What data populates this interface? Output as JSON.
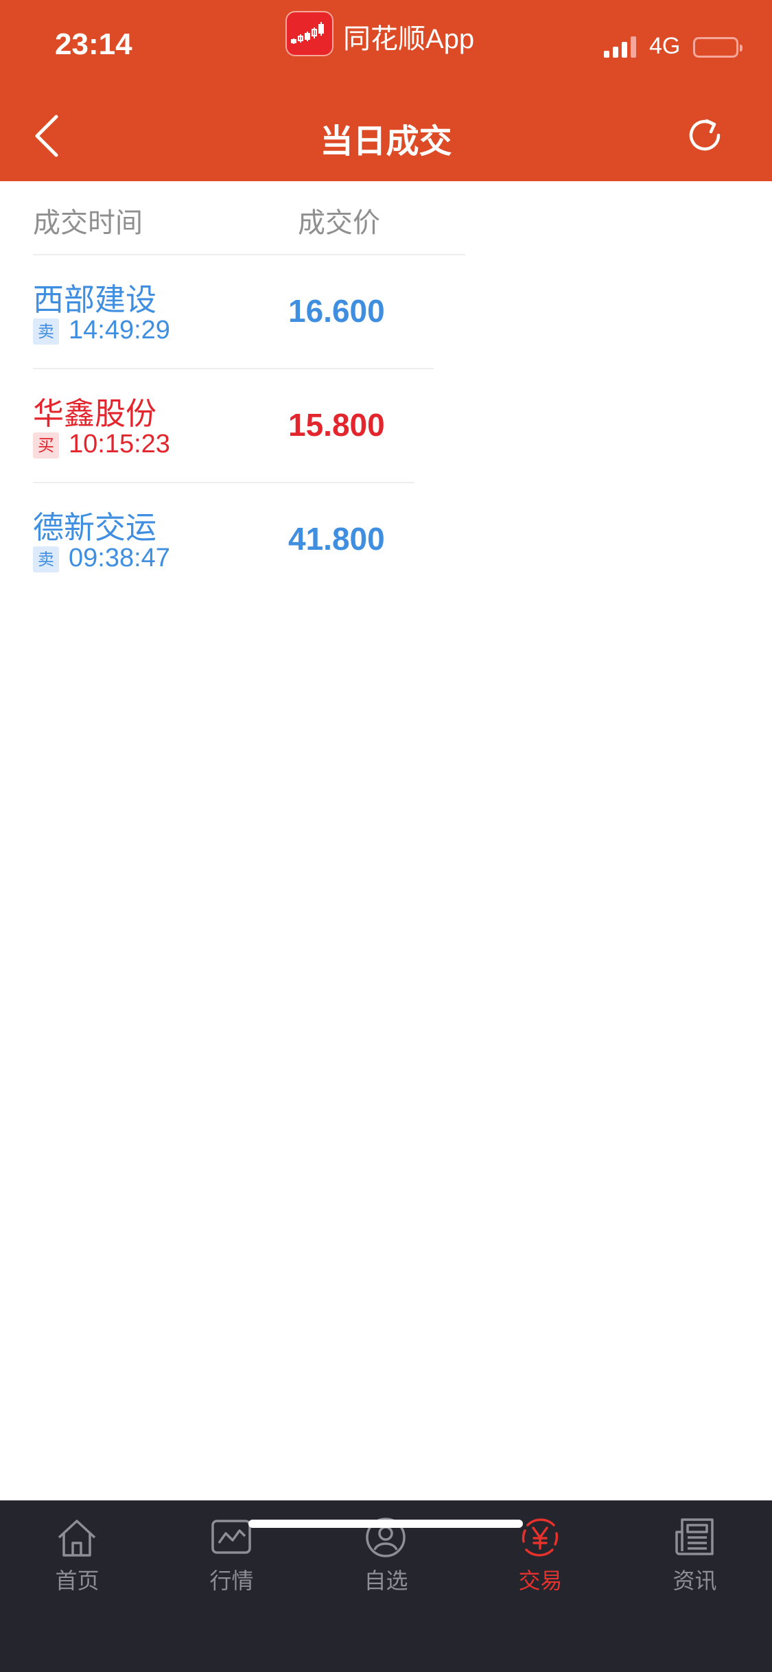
{
  "status_bar": {
    "time": "23:14",
    "app_name": "同花顺App",
    "network": "4G"
  },
  "nav": {
    "title": "当日成交",
    "back_icon": "chevron-left-icon",
    "refresh_icon": "refresh-icon"
  },
  "columns": [
    "成交时间",
    "成交价"
  ],
  "trades": [
    {
      "name": "西部建设",
      "side": "卖",
      "time": "14:49:29",
      "price": "16.600",
      "type": "sell"
    },
    {
      "name": "华鑫股份",
      "side": "买",
      "time": "10:15:23",
      "price": "15.800",
      "type": "buy"
    },
    {
      "name": "德新交运",
      "side": "卖",
      "time": "09:38:47",
      "price": "41.800",
      "type": "sell"
    }
  ],
  "tabs": [
    {
      "label": "首页",
      "icon": "home-icon"
    },
    {
      "label": "行情",
      "icon": "chart-icon"
    },
    {
      "label": "自选",
      "icon": "person-icon"
    },
    {
      "label": "交易",
      "icon": "yen-trade-icon",
      "active": true
    },
    {
      "label": "资讯",
      "icon": "news-icon"
    }
  ],
  "colors": {
    "header": "#dc4b26",
    "sell": "#3f8ee0",
    "buy": "#e3262e",
    "tabbar": "#25252d",
    "tab_active": "#e5322d"
  }
}
